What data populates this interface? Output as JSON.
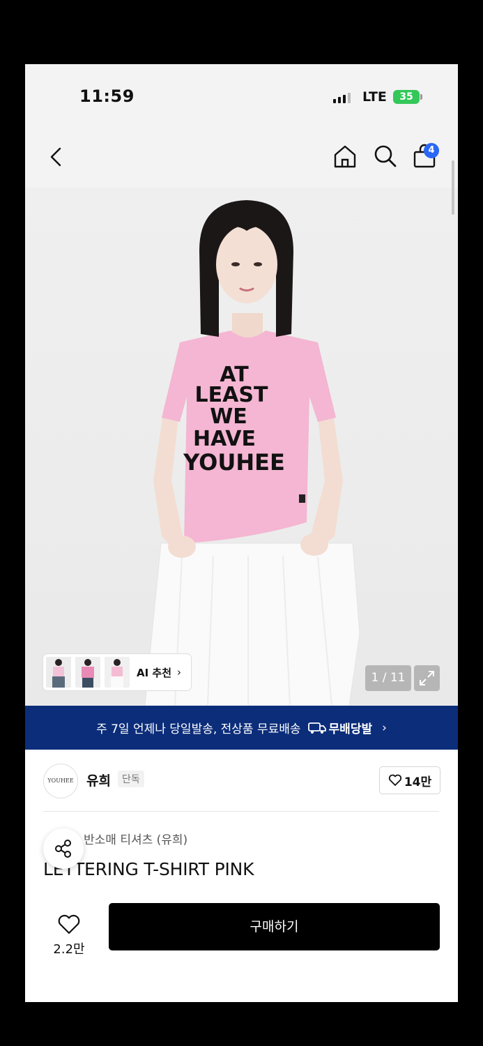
{
  "status": {
    "time": "11:59",
    "network": "LTE",
    "battery": "35"
  },
  "nav": {
    "cart_count": "4"
  },
  "hero": {
    "shirt_lines": [
      "AT",
      "LEAST",
      "WE",
      "HAVE",
      "YOUHEE"
    ],
    "ai_label": "AI 추천",
    "counter": "1 / 11"
  },
  "banner": {
    "text": "주 7일 언제나 당일발송, 전상품 무료배송",
    "brand": "무배당발"
  },
  "brand": {
    "logo_text": "YOUHEE",
    "name": "유희",
    "exclusive": "단독",
    "likes": "14만"
  },
  "product": {
    "category": "반소매 티셔츠 (유희)",
    "title": "LETTERING T-SHIRT PINK"
  },
  "bottom_bar": {
    "wish_count": "2.2만",
    "buy_label": "구매하기"
  },
  "colors": {
    "banner_bg": "#0b2d7a",
    "badge": "#2b66f6",
    "shirt": "#f4b6d2",
    "buy_bg": "#000000"
  }
}
